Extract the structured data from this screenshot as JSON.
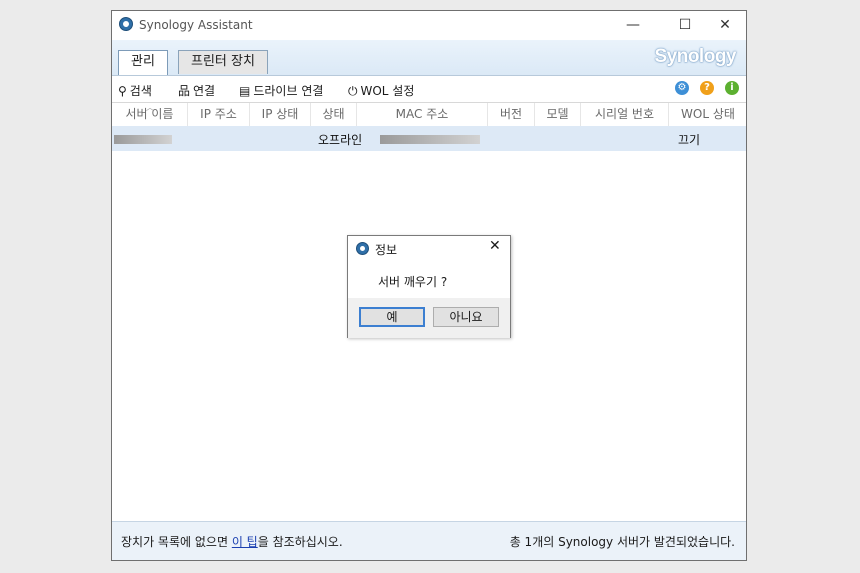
{
  "window": {
    "title": "Synology Assistant",
    "controls": [
      "—",
      "☐",
      "✕"
    ]
  },
  "tabs": [
    {
      "label": "관리"
    },
    {
      "label": "프린터 장치"
    }
  ],
  "logo": "Synology",
  "toolbar": {
    "items": [
      {
        "icon": "search-icon",
        "label": "검색"
      },
      {
        "icon": "network-icon",
        "label": "연결"
      },
      {
        "icon": "drive-icon",
        "label": "드라이브 연결"
      },
      {
        "icon": "power-icon",
        "label": "WOL 설정"
      }
    ],
    "right_icons": [
      "gear-icon",
      "help-icon",
      "info-icon"
    ]
  },
  "table": {
    "columns": [
      "서버 이름",
      "IP 주소",
      "IP 상태",
      "상태",
      "MAC 주소",
      "버전",
      "모델",
      "시리얼 번호",
      "WOL 상태"
    ],
    "rows": [
      {
        "status": "오프라인",
        "wol_status": "끄기"
      }
    ]
  },
  "statusbar": {
    "left_prefix": "장치가 목록에 없으면 ",
    "left_link": "이 팁",
    "left_suffix": "을 참조하십시오.",
    "right": "총 1개의 Synology 서버가 발견되었습니다."
  },
  "dialog": {
    "title": "정보",
    "message": "서버 깨우기 ?",
    "yes": "예",
    "no": "아니요"
  },
  "colors": {
    "accent": "#3c7fd1",
    "selected_row": "#dde9f6",
    "band": "#dbe9f6",
    "link": "#1a3fb0"
  }
}
